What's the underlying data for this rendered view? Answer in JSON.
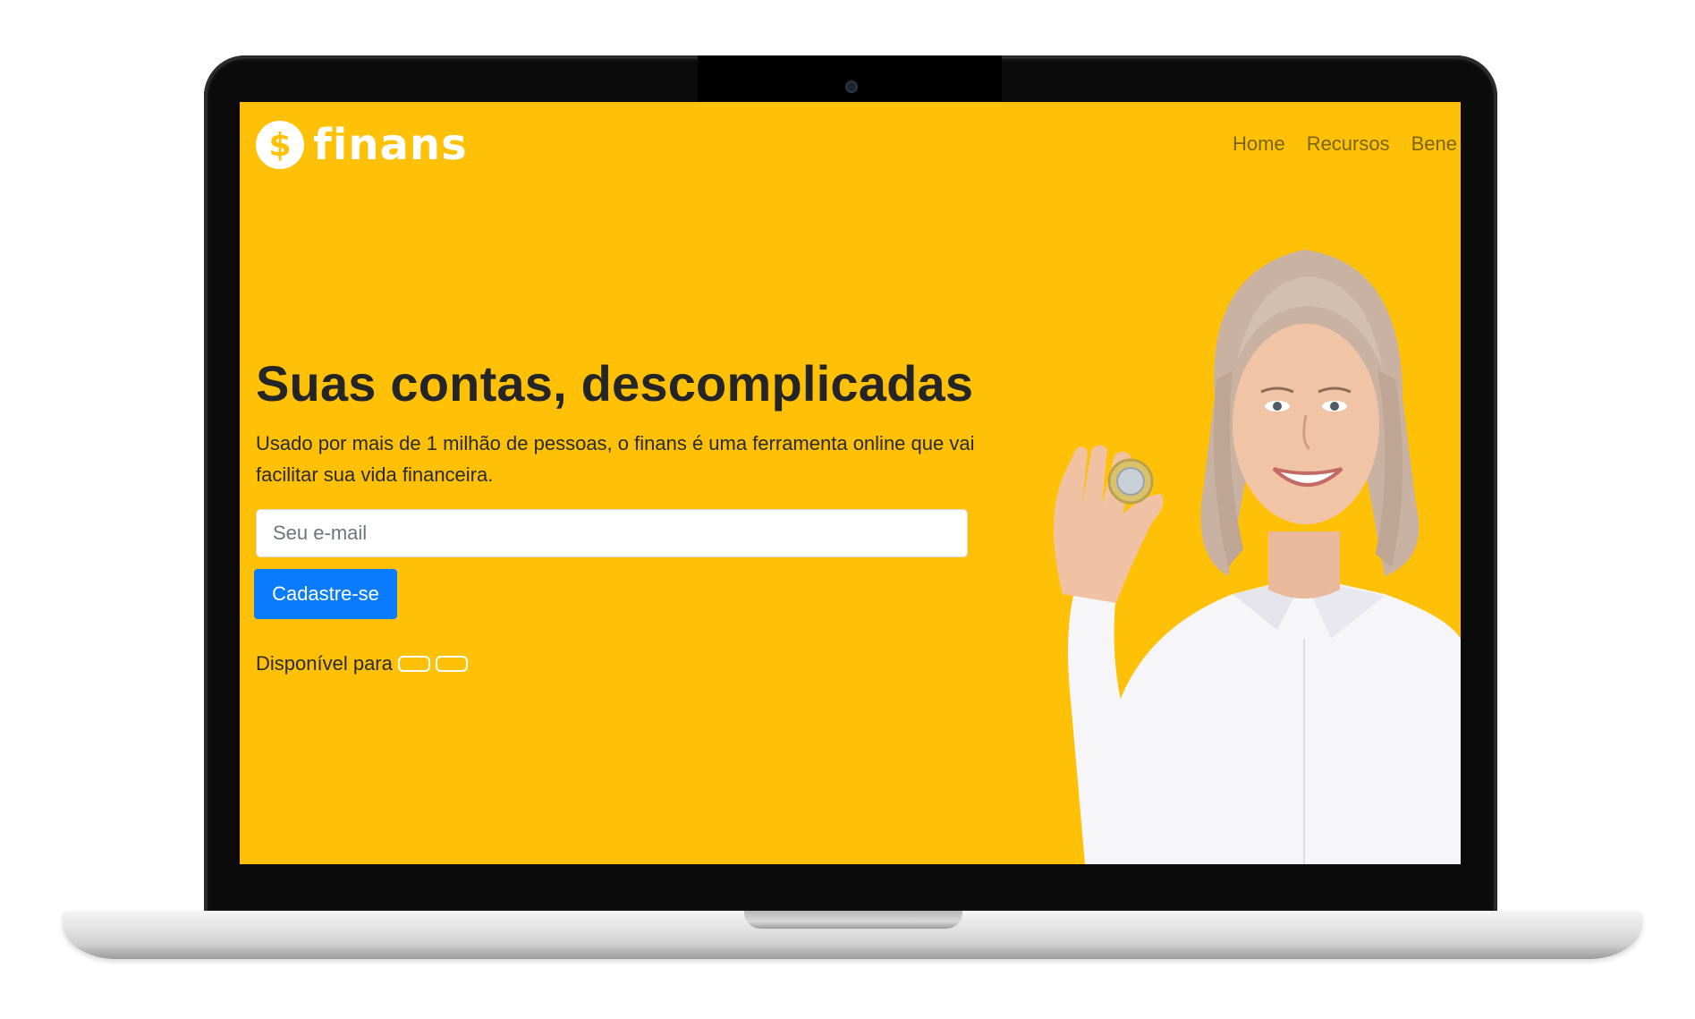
{
  "site": {
    "logo_symbol": "$",
    "logo_text": "finans"
  },
  "nav": {
    "items": [
      "Home",
      "Recursos",
      "Bene"
    ]
  },
  "hero": {
    "title": "Suas contas, descomplicadas",
    "description": "Usado por mais de 1 milhão de pessoas, o finans é uma ferramenta online que vai facilitar sua vida financeira.",
    "email_placeholder": "Seu e-mail",
    "signup_label": "Cadastre-se",
    "available_label": "Disponível para"
  },
  "colors": {
    "background": "#fec107",
    "button": "#0a7bfd",
    "logo": "#ffffff"
  },
  "icons": {
    "logo": "dollar-coin-icon",
    "stores": [
      "app-store-badge",
      "play-store-badge"
    ]
  }
}
